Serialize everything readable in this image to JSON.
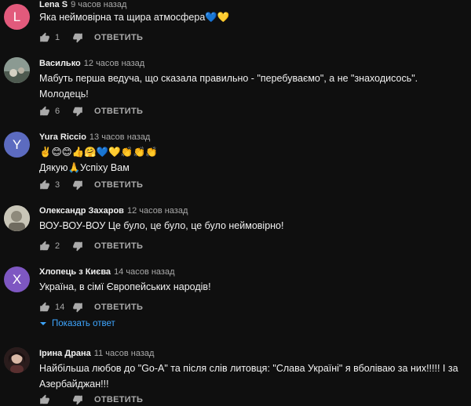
{
  "comments": [
    {
      "author": "Lena S",
      "time": "9 часов назад",
      "avatar_letter": "L",
      "avatar_color": "#e25a7c",
      "lines": [
        "Яка неймовірна та щира атмосфера💙💛"
      ],
      "likes": "1",
      "reply": "ОТВЕТИТЬ"
    },
    {
      "author": "Василько",
      "time": "12 часов назад",
      "avatar_color": "#7a8a80",
      "lines": [
        "Мабуть перша ведуча, що сказала правильно - \"перебуваємо\", а не \"знаходисось\".",
        "Молодець!"
      ],
      "likes": "6",
      "reply": "ОТВЕТИТЬ"
    },
    {
      "author": "Yura Riccio",
      "time": "13 часов назад",
      "avatar_letter": "Y",
      "avatar_color": "#5c6bc0",
      "lines": [
        "✌️😊😊👍🤗💙💛👏👏👏",
        "Дякую🙏Успіху Вам"
      ],
      "likes": "3",
      "reply": "ОТВЕТИТЬ"
    },
    {
      "author": "Олександр Захаров",
      "time": "12 часов назад",
      "avatar_color": "#b9b6a8",
      "lines": [
        "ВОУ-ВОУ-ВОУ Це було, це було, це було неймовірно!"
      ],
      "likes": "2",
      "reply": "ОТВЕТИТЬ"
    },
    {
      "author": "Хлопець з Києва",
      "time": "14 часов назад",
      "avatar_letter": "X",
      "avatar_color": "#7e57c2",
      "lines": [
        "Україна, в сімї Європейських народів!"
      ],
      "likes": "14",
      "reply": "ОТВЕТИТЬ",
      "show_replies": "Показать ответ"
    },
    {
      "author": "Ірина Драна",
      "time": "11 часов назад",
      "avatar_color": "#3a2a2a",
      "lines": [
        "Найбільша любов до \"Go-A\" та після слів литовця: \"Слава Україні\" я вболіваю за них!!!!! І за",
        "Азербайджан!!!"
      ],
      "likes": "",
      "reply": "ОТВЕТИТЬ"
    }
  ]
}
